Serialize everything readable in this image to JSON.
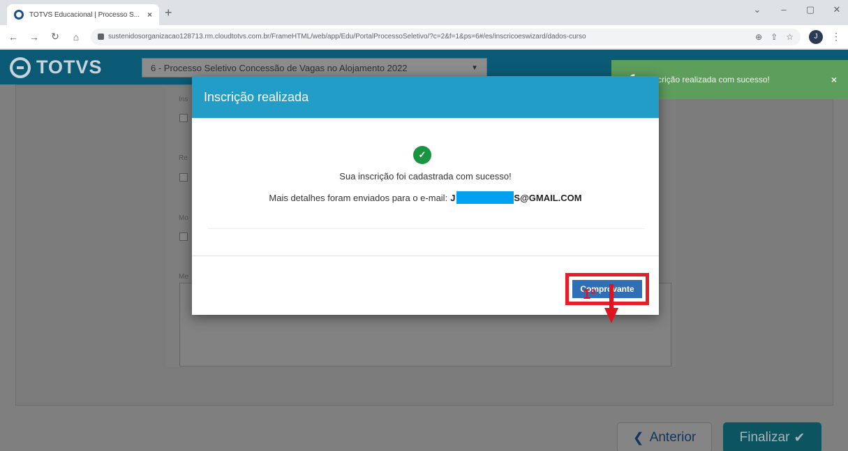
{
  "browser": {
    "tab_title": "TOTVS Educacional | Processo S...",
    "tab_close": "×",
    "new_tab": "+",
    "url": "sustenidosorganizacao128713.rm.cloudtotvs.com.br/FrameHTML/web/app/Edu/PortalProcessoSeletivo/?c=2&f=1&ps=6#/es/inscricoeswizard/dados-curso",
    "profile_initial": "J"
  },
  "app": {
    "logo_text": "TOTVS",
    "process_select": "6 - Processo Seletivo Concessão de Vagas no Alojamento 2022",
    "form_labels": [
      "Ins",
      "Re",
      "Mo",
      "Me"
    ]
  },
  "toast": {
    "message": "Inscrição realizada com sucesso!",
    "close": "×"
  },
  "modal": {
    "title": "Inscrição realizada",
    "success_message": "Sua inscrição foi cadastrada com sucesso!",
    "email_prefix": "Mais detalhes foram enviados para o e-mail:",
    "email_start": "J",
    "email_end": "S@GMAIL.COM",
    "comprovante_label": "Comprovante"
  },
  "annotation": {
    "step_label": "1º"
  },
  "footer": {
    "anterior_label": "Anterior",
    "finalizar_label": "Finalizar"
  },
  "colors": {
    "header": "#0b5a75",
    "modal_header": "#219dc8",
    "toast": "#5e9e5d",
    "highlight": "#e61e2a",
    "redaction": "#00a2ef"
  }
}
